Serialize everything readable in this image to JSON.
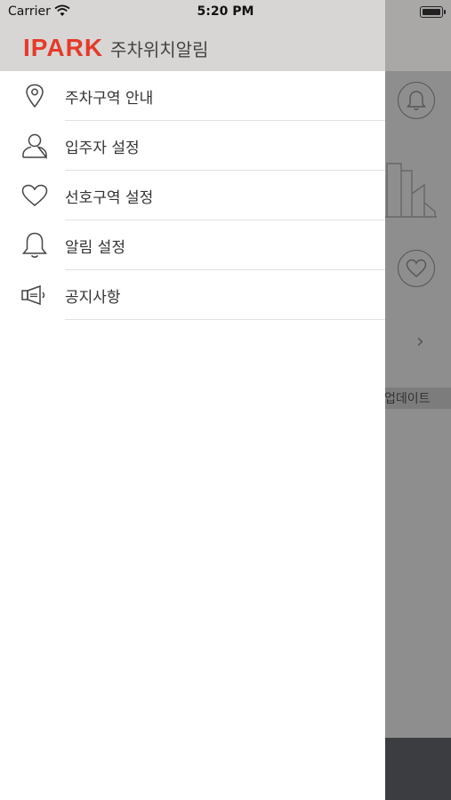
{
  "status_bar": {
    "carrier": "Carrier",
    "time": "5:20 PM"
  },
  "drawer": {
    "logo": "IPARK",
    "title": "주차위치알림",
    "items": [
      {
        "label": "주차구역 안내",
        "icon": "location-pin-icon"
      },
      {
        "label": "입주자 설정",
        "icon": "person-icon"
      },
      {
        "label": "선호구역 설정",
        "icon": "heart-icon"
      },
      {
        "label": "알림 설정",
        "icon": "bell-icon"
      },
      {
        "label": "공지사항",
        "icon": "megaphone-icon"
      }
    ]
  },
  "background": {
    "update_text": "업데이트"
  },
  "colors": {
    "brand_red": "#e53a2b",
    "header_gray": "#d8d6d4",
    "overlay_gray": "#8e8e8e"
  }
}
